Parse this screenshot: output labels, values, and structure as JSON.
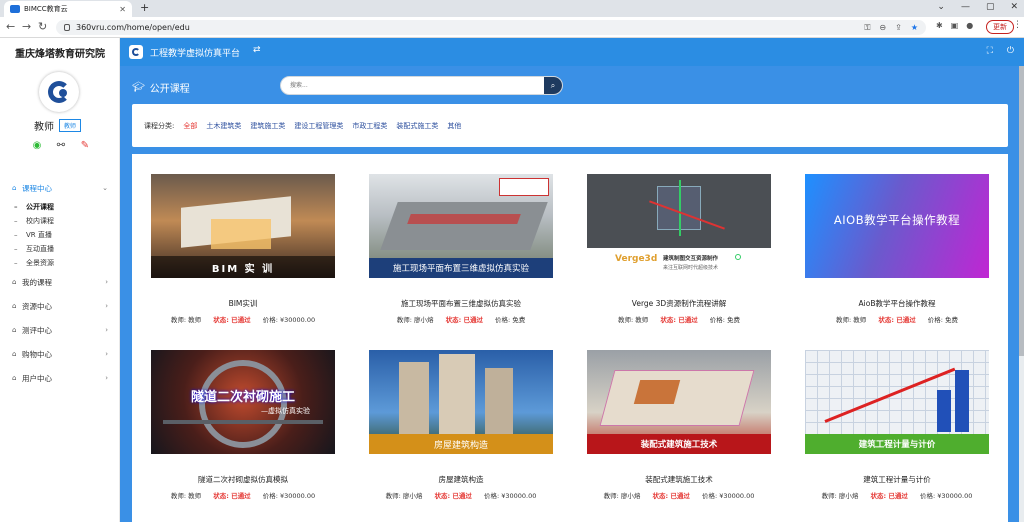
{
  "browser": {
    "tab_title": "BIMCC教育云",
    "url": "360vru.com/home/open/edu",
    "update_label": "更新"
  },
  "sidebar": {
    "org_title": "重庆烽塔教育研究院",
    "role": "教师",
    "role_badge": "教师",
    "menu": [
      {
        "label": "课程中心"
      },
      {
        "label": "我的课程"
      },
      {
        "label": "资源中心"
      },
      {
        "label": "测评中心"
      },
      {
        "label": "购物中心"
      },
      {
        "label": "用户中心"
      }
    ],
    "submenu": [
      {
        "label": "公开课程"
      },
      {
        "label": "校内课程"
      },
      {
        "label": "VR 直播"
      },
      {
        "label": "互动直播"
      },
      {
        "label": "全景资源"
      }
    ]
  },
  "header": {
    "title": "工程教学虚拟仿真平台"
  },
  "banner": {
    "title": "公开课程",
    "search_placeholder": "搜索..."
  },
  "filter": {
    "label": "课程分类:",
    "options": [
      "全部",
      "土木建筑类",
      "建筑施工类",
      "建设工程管理类",
      "市政工程类",
      "装配式施工类",
      "其他"
    ]
  },
  "labels": {
    "teacher_prefix": "教师: ",
    "status_prefix": "状态: ",
    "price_prefix": "价格: "
  },
  "courses": [
    {
      "title": "BIM实训",
      "teacher": "教师",
      "status": "已通过",
      "price": "¥30000.00",
      "thumb_text": "BIM 实 训"
    },
    {
      "title": "施工现场平面布置三维虚拟仿真实验",
      "teacher": "廖小熔",
      "status": "已通过",
      "price": "免费",
      "thumb_text": "施工现场平面布置三维虚拟仿真实验"
    },
    {
      "title": "Verge 3D资源制作流程讲解",
      "teacher": "教师",
      "status": "已通过",
      "price": "免费",
      "thumb_text": "Verge3d",
      "thumb_sub": "建筑制图交互资源制作",
      "thumb_sub2": "来注互联网时代超级技术"
    },
    {
      "title": "AioB教学平台操作教程",
      "teacher": "教师",
      "status": "已通过",
      "price": "免费",
      "thumb_text": "AIOB教学平台操作教程"
    },
    {
      "title": "隧道二次衬砌虚拟仿真模拟",
      "teacher": "教师",
      "status": "已通过",
      "price": "¥30000.00",
      "thumb_text": "隧道二次衬砌施工",
      "thumb_sub": "—虚拟仿真实验"
    },
    {
      "title": "房屋建筑构造",
      "teacher": "廖小熔",
      "status": "已通过",
      "price": "¥30000.00",
      "thumb_text": "房屋建筑构造"
    },
    {
      "title": "装配式建筑施工技术",
      "teacher": "廖小熔",
      "status": "已通过",
      "price": "¥30000.00",
      "thumb_text": "装配式建筑施工技术"
    },
    {
      "title": "建筑工程计量与计价",
      "teacher": "廖小熔",
      "status": "已通过",
      "price": "¥30000.00",
      "thumb_text": "建筑工程计量与计价"
    }
  ]
}
